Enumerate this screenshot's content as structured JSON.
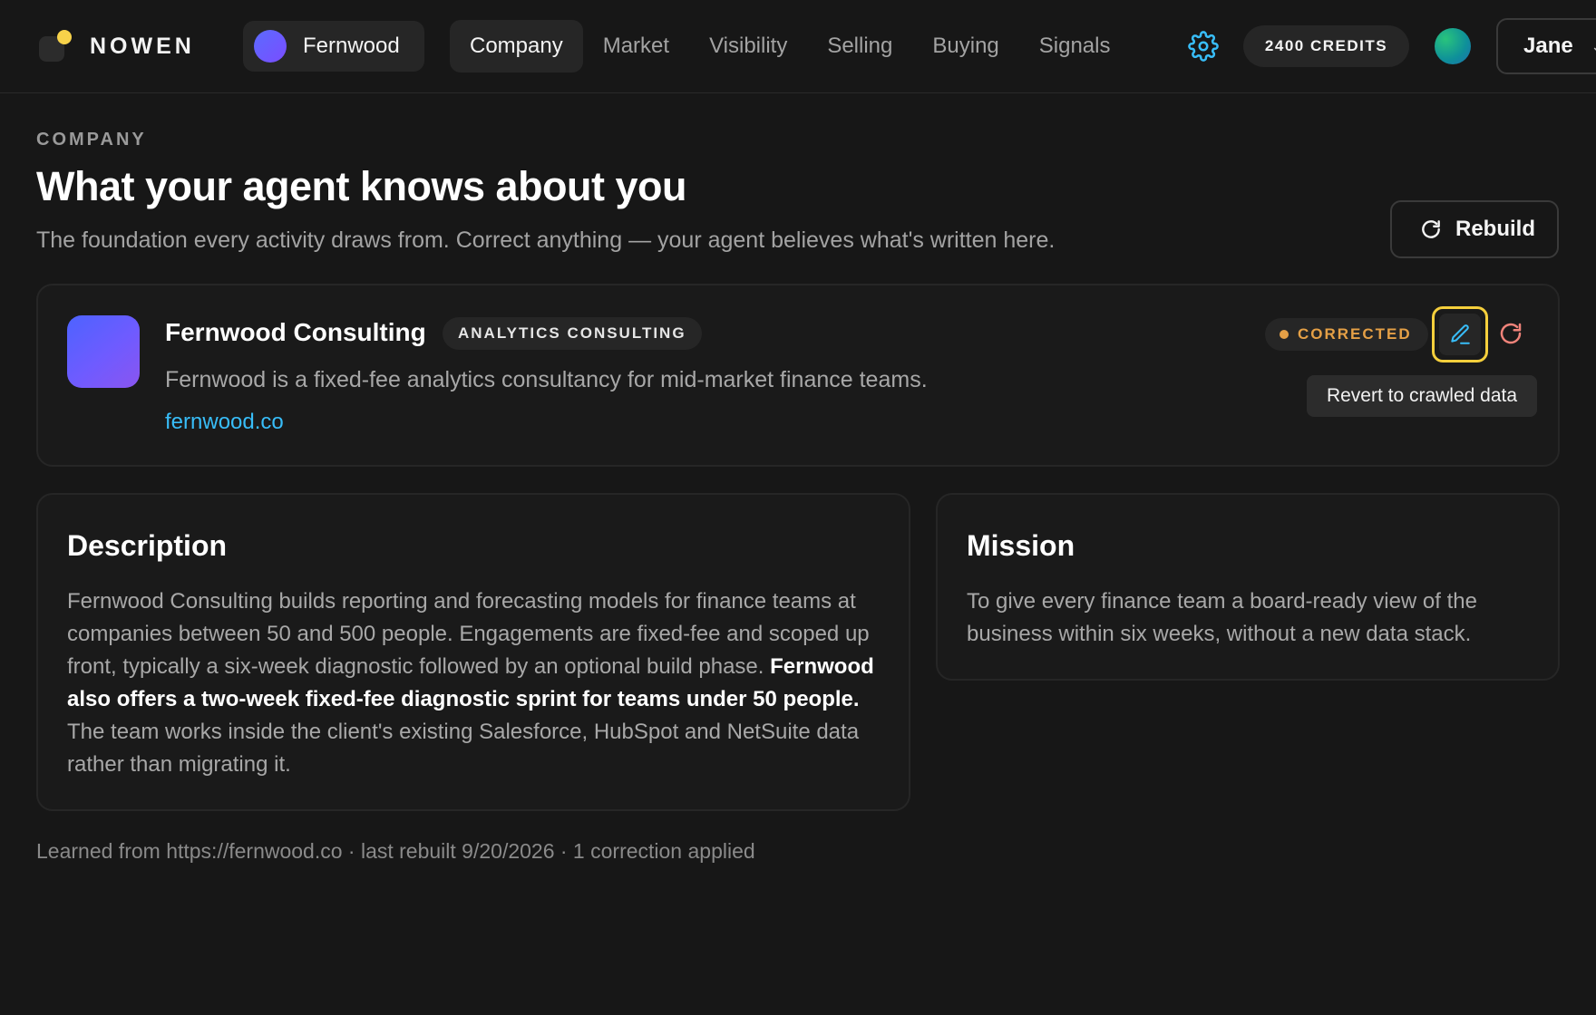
{
  "brand": {
    "name": "NOWEN"
  },
  "workspace": {
    "name": "Fernwood"
  },
  "nav": {
    "items": [
      "Company",
      "Market",
      "Visibility",
      "Selling",
      "Buying",
      "Signals"
    ],
    "active": "Company"
  },
  "header": {
    "credits": "2400 CREDITS",
    "user": "Jane"
  },
  "page": {
    "eyebrow": "COMPANY",
    "title": "What your agent knows about you",
    "subtitle": "The foundation every activity draws from. Correct anything — your agent believes what's written here.",
    "rebuild_label": "Rebuild"
  },
  "company": {
    "name": "Fernwood Consulting",
    "category": "ANALYTICS CONSULTING",
    "tagline": "Fernwood is a fixed-fee analytics consultancy for mid-market finance teams.",
    "website": "fernwood.co",
    "status": "CORRECTED",
    "tooltip": "Revert to crawled data"
  },
  "description": {
    "title": "Description",
    "text_before": "Fernwood Consulting builds reporting and forecasting models for finance teams at companies between 50 and 500 people. Engagements are fixed-fee and scoped up front, typically a six-week diagnostic followed by an optional build phase. ",
    "text_highlight": "Fernwood also offers a two-week fixed-fee diagnostic sprint for teams under 50 people.",
    "text_after": " The team works inside the client's existing Salesforce, HubSpot and NetSuite data rather than migrating it."
  },
  "mission": {
    "title": "Mission",
    "text": "To give every finance team a board-ready view of the business within six weeks, without a new data stack."
  },
  "footer": {
    "note": "Learned from https://fernwood.co · last rebuilt 9/20/2026 · 1 correction applied"
  },
  "colors": {
    "background": "#171717",
    "link": "#38bdf8",
    "status_warning": "#e5a046",
    "focus_ring": "#f5cf3c",
    "revert": "#f0837a"
  },
  "icons": {
    "settings": "gear-icon",
    "rebuild": "refresh-icon",
    "edit": "pencil-icon",
    "revert": "revert-icon"
  }
}
